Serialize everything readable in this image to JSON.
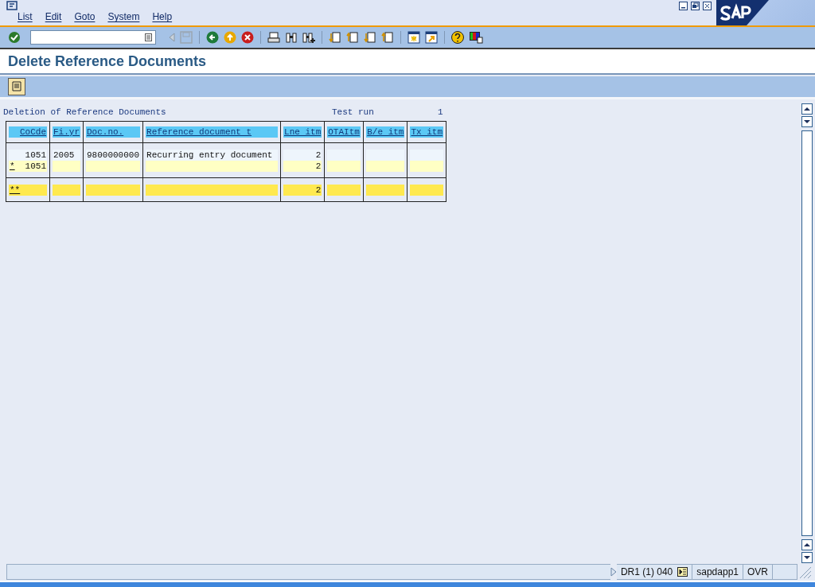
{
  "menu": [
    "List",
    "Edit",
    "Goto",
    "System",
    "Help"
  ],
  "title": "Delete Reference Documents",
  "report": {
    "heading": "Deletion of Reference Documents",
    "test_run_label": "Test run",
    "test_run_value": "1"
  },
  "table": {
    "columns": [
      "CoCde",
      "Fi.yr",
      "Doc.no.",
      "Reference document t",
      "Lne itm",
      "OTAItm",
      "B/e itm",
      "Tx itm"
    ],
    "rows": [
      {
        "kind": "line",
        "marker": null,
        "cells": [
          "1051",
          "2005",
          "9800000000",
          "Recurring entry document",
          "2",
          null,
          null,
          null
        ]
      },
      {
        "kind": "subtotal",
        "marker": "*",
        "cells": [
          "1051",
          null,
          null,
          null,
          "2",
          null,
          null,
          null
        ]
      },
      {
        "kind": "total",
        "marker": "**",
        "cells": [
          null,
          null,
          null,
          null,
          "2",
          null,
          null,
          null
        ]
      }
    ]
  },
  "status_bar": {
    "system": "DR1 (1) 040",
    "server": "sapdapp1",
    "mode": "OVR"
  }
}
